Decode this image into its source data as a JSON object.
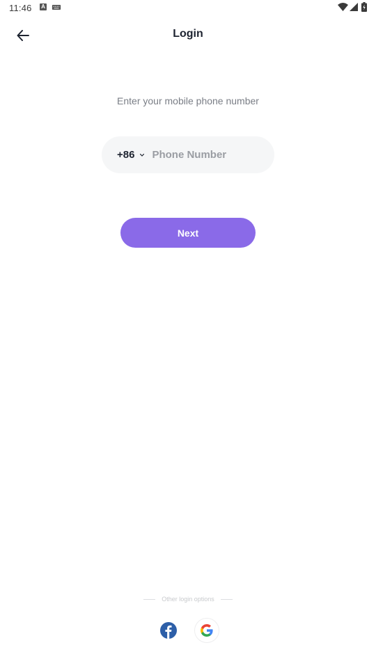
{
  "status_bar": {
    "time": "11:46",
    "icons": [
      "text-a-icon",
      "keyboard-icon",
      "wifi-icon",
      "signal-icon",
      "battery-icon"
    ]
  },
  "header": {
    "back_icon": "arrow-left-icon",
    "title": "Login"
  },
  "form": {
    "prompt": "Enter your mobile phone number",
    "country_code": "+86",
    "country_chevron_icon": "chevron-down-icon",
    "phone_value": "",
    "phone_placeholder": "Phone Number",
    "next_label": "Next"
  },
  "other_login": {
    "label": "Other login options",
    "options": [
      {
        "name": "facebook",
        "icon": "facebook-icon"
      },
      {
        "name": "google",
        "icon": "google-icon"
      }
    ]
  },
  "colors": {
    "accent": "#8a6ae8",
    "input_bg": "#f5f6f7",
    "facebook": "#2d5fa8"
  }
}
